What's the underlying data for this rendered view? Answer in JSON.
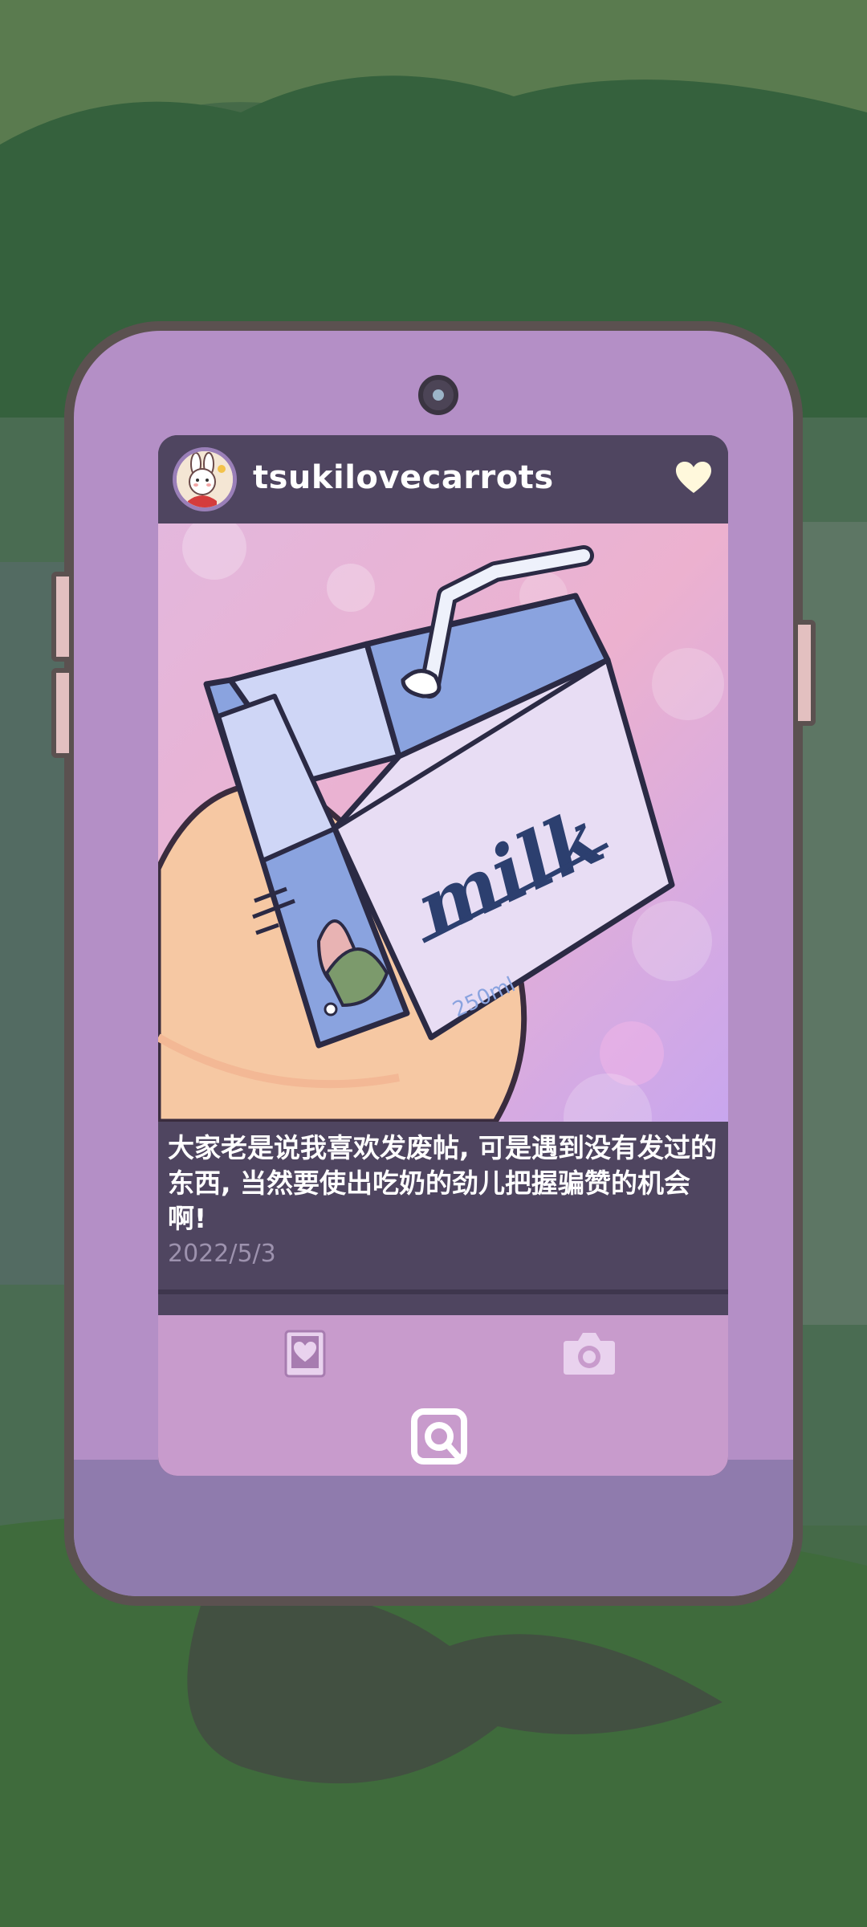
{
  "post": {
    "username": "tsukilovecarrots",
    "caption": "大家老是说我喜欢发废帖, 可是遇到没有发过的东西, 当然要使出吃奶的劲儿把握骗赞的机会啊!",
    "date": "2022/5/3",
    "image_text": {
      "carton_label": "milk",
      "volume": "250ml"
    }
  },
  "icons": {
    "heart": "heart-icon",
    "journal": "journal-heart-icon",
    "camera": "camera-icon",
    "home": "app-home-icon"
  },
  "colors": {
    "phone_body": "#b48fc6",
    "screen_bg": "#4f4560",
    "tab_bar": "#c89bcc",
    "heart": "#fff8dc",
    "date": "#9d92ae"
  }
}
